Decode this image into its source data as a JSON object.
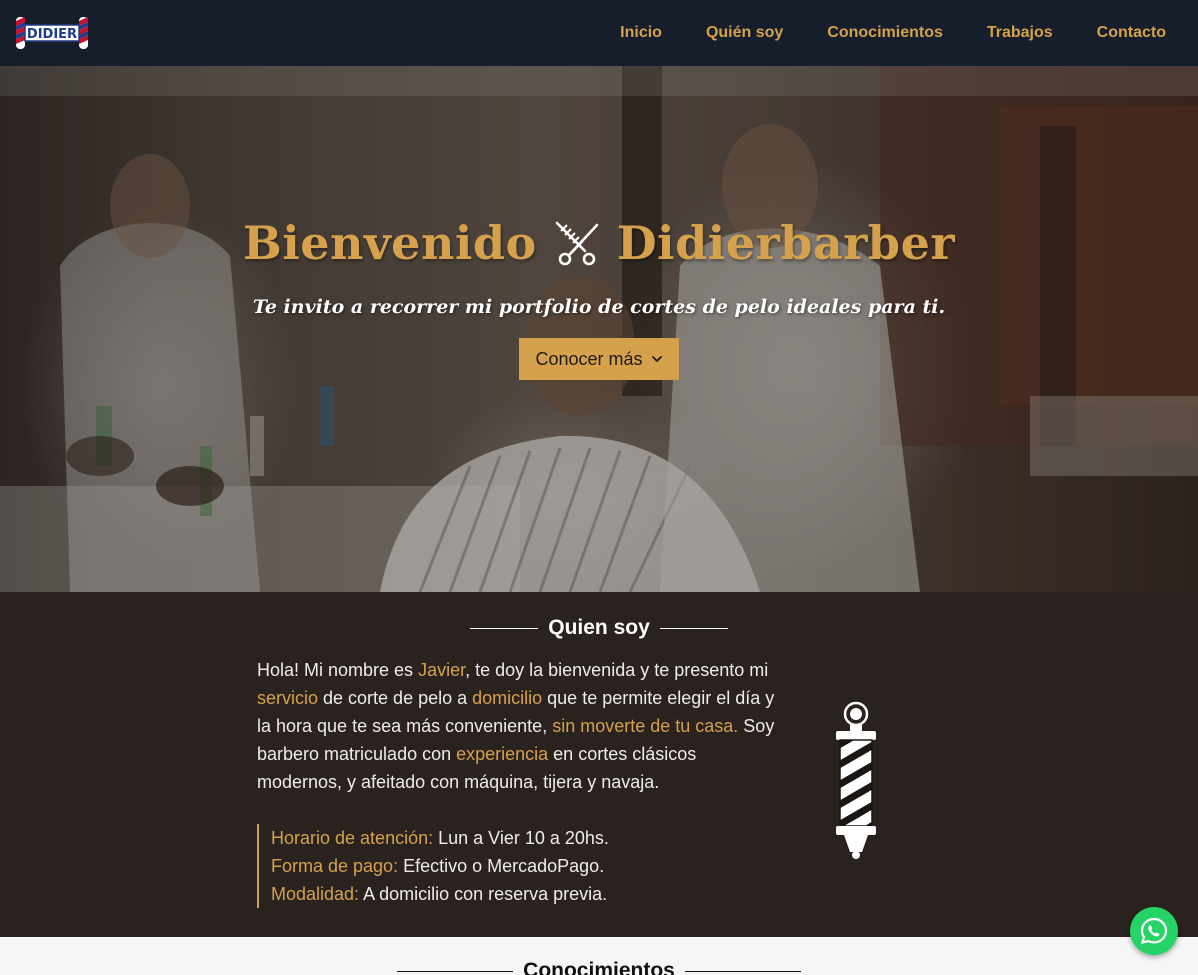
{
  "brand": {
    "logo_text": "DIDIER"
  },
  "nav": {
    "items": [
      {
        "label": "Inicio"
      },
      {
        "label": "Quién soy"
      },
      {
        "label": "Conocimientos"
      },
      {
        "label": "Trabajos"
      },
      {
        "label": "Contacto"
      }
    ]
  },
  "hero": {
    "title_left": "Bienvenido",
    "title_right": "Didierbarber",
    "subtitle": "Te invito a recorrer mi portfolio de cortes de pelo ideales para ti.",
    "cta_label": "Conocer más"
  },
  "about": {
    "heading": "Quien soy",
    "paragraph": [
      {
        "t": "Hola! Mi nombre es "
      },
      {
        "t": "Javier",
        "hl": true
      },
      {
        "t": ", te doy la bienvenida y te presento mi "
      },
      {
        "t": "servicio",
        "hl": true
      },
      {
        "t": " de corte de pelo a "
      },
      {
        "t": "domicilio",
        "hl": true
      },
      {
        "t": " que te permite elegir el día y la hora que te sea más conveniente, "
      },
      {
        "t": "sin moverte de tu casa.",
        "hl": true
      },
      {
        "t": " Soy barbero matriculado con "
      },
      {
        "t": "experiencia",
        "hl": true
      },
      {
        "t": " en cortes clásicos modernos, y afeitado con máquina, tijera y navaja."
      }
    ],
    "info": [
      {
        "label": "Horario de atención:",
        "value": " Lun a Vier 10 a 20hs."
      },
      {
        "label": "Forma de pago:",
        "value": " Efectivo o MercadoPago."
      },
      {
        "label": "Modalidad:",
        "value": " A domicilio con reserva previa."
      }
    ]
  },
  "knowledge": {
    "heading": "Conocimientos"
  },
  "colors": {
    "accent": "#d6a14c",
    "navbar": "#161d2b",
    "about_bg": "#2a221f",
    "whatsapp": "#25d366"
  },
  "icons": [
    "logo-icon",
    "scissors-comb-icon",
    "chevron-down-icon",
    "barber-pole-icon",
    "whatsapp-icon"
  ]
}
